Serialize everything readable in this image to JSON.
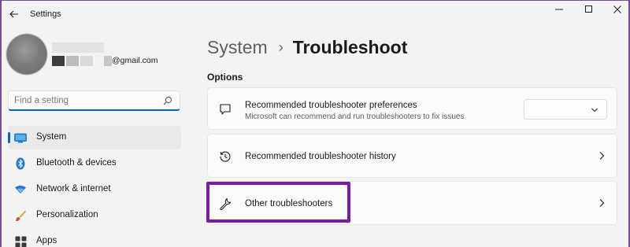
{
  "window": {
    "title": "Settings",
    "accent_color": "#0067c0",
    "highlight_color": "#7b19a8"
  },
  "profile": {
    "email_suffix": "@gmail.com"
  },
  "search": {
    "placeholder": "Find a setting"
  },
  "sidebar": {
    "items": [
      {
        "label": "System",
        "icon": "monitor-icon",
        "active": true
      },
      {
        "label": "Bluetooth & devices",
        "icon": "bluetooth-icon",
        "active": false
      },
      {
        "label": "Network & internet",
        "icon": "wifi-icon",
        "active": false
      },
      {
        "label": "Personalization",
        "icon": "brush-icon",
        "active": false
      },
      {
        "label": "Apps",
        "icon": "apps-icon",
        "active": false
      }
    ]
  },
  "breadcrumb": {
    "parent": "System",
    "separator": "›",
    "current": "Troubleshoot"
  },
  "main": {
    "section_label": "Options",
    "cards": [
      {
        "title": "Recommended troubleshooter preferences",
        "description": "Microsoft can recommend and run troubleshooters to fix issues",
        "icon": "chat-bubble-icon",
        "control": "dropdown",
        "dropdown_value": ""
      },
      {
        "title": "Recommended troubleshooter history",
        "icon": "history-icon",
        "control": "chevron"
      },
      {
        "title": "Other troubleshooters",
        "icon": "wrench-icon",
        "control": "chevron",
        "highlighted": true
      }
    ]
  }
}
